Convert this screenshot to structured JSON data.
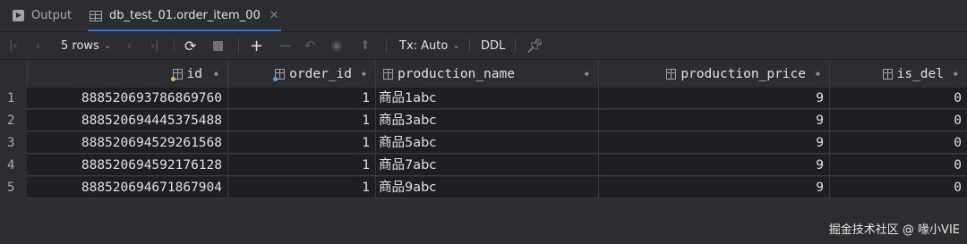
{
  "tabs": {
    "output_label": "Output",
    "table_label": "db_test_01.order_item_00",
    "close_glyph": "✕"
  },
  "toolbar": {
    "rows_label": "5 rows",
    "tx_label": "Tx: Auto",
    "ddl_label": "DDL"
  },
  "columns": [
    {
      "label": "id",
      "icon": "primary-key-column-icon"
    },
    {
      "label": "order_id",
      "icon": "indexed-column-icon"
    },
    {
      "label": "production_name",
      "icon": "column-icon"
    },
    {
      "label": "production_price",
      "icon": "column-icon"
    },
    {
      "label": "is_del",
      "icon": "column-icon"
    }
  ],
  "rows": [
    {
      "num": "1",
      "id": "888520693786869760",
      "order_id": "1",
      "production_name": "商品1abc",
      "production_price": "9",
      "is_del": "0"
    },
    {
      "num": "2",
      "id": "888520694445375488",
      "order_id": "1",
      "production_name": "商品3abc",
      "production_price": "9",
      "is_del": "0"
    },
    {
      "num": "3",
      "id": "888520694529261568",
      "order_id": "1",
      "production_name": "商品5abc",
      "production_price": "9",
      "is_del": "0"
    },
    {
      "num": "4",
      "id": "888520694592176128",
      "order_id": "1",
      "production_name": "商品7abc",
      "production_price": "9",
      "is_del": "0"
    },
    {
      "num": "5",
      "id": "888520694671867904",
      "order_id": "1",
      "production_name": "商品9abc",
      "production_price": "9",
      "is_del": "0"
    }
  ],
  "watermark": "掘金技术社区 @ 喙小VIE",
  "colors": {
    "accent": "#3574f0",
    "background": "#2b2d30",
    "cell_bg": "#1e1f22"
  }
}
